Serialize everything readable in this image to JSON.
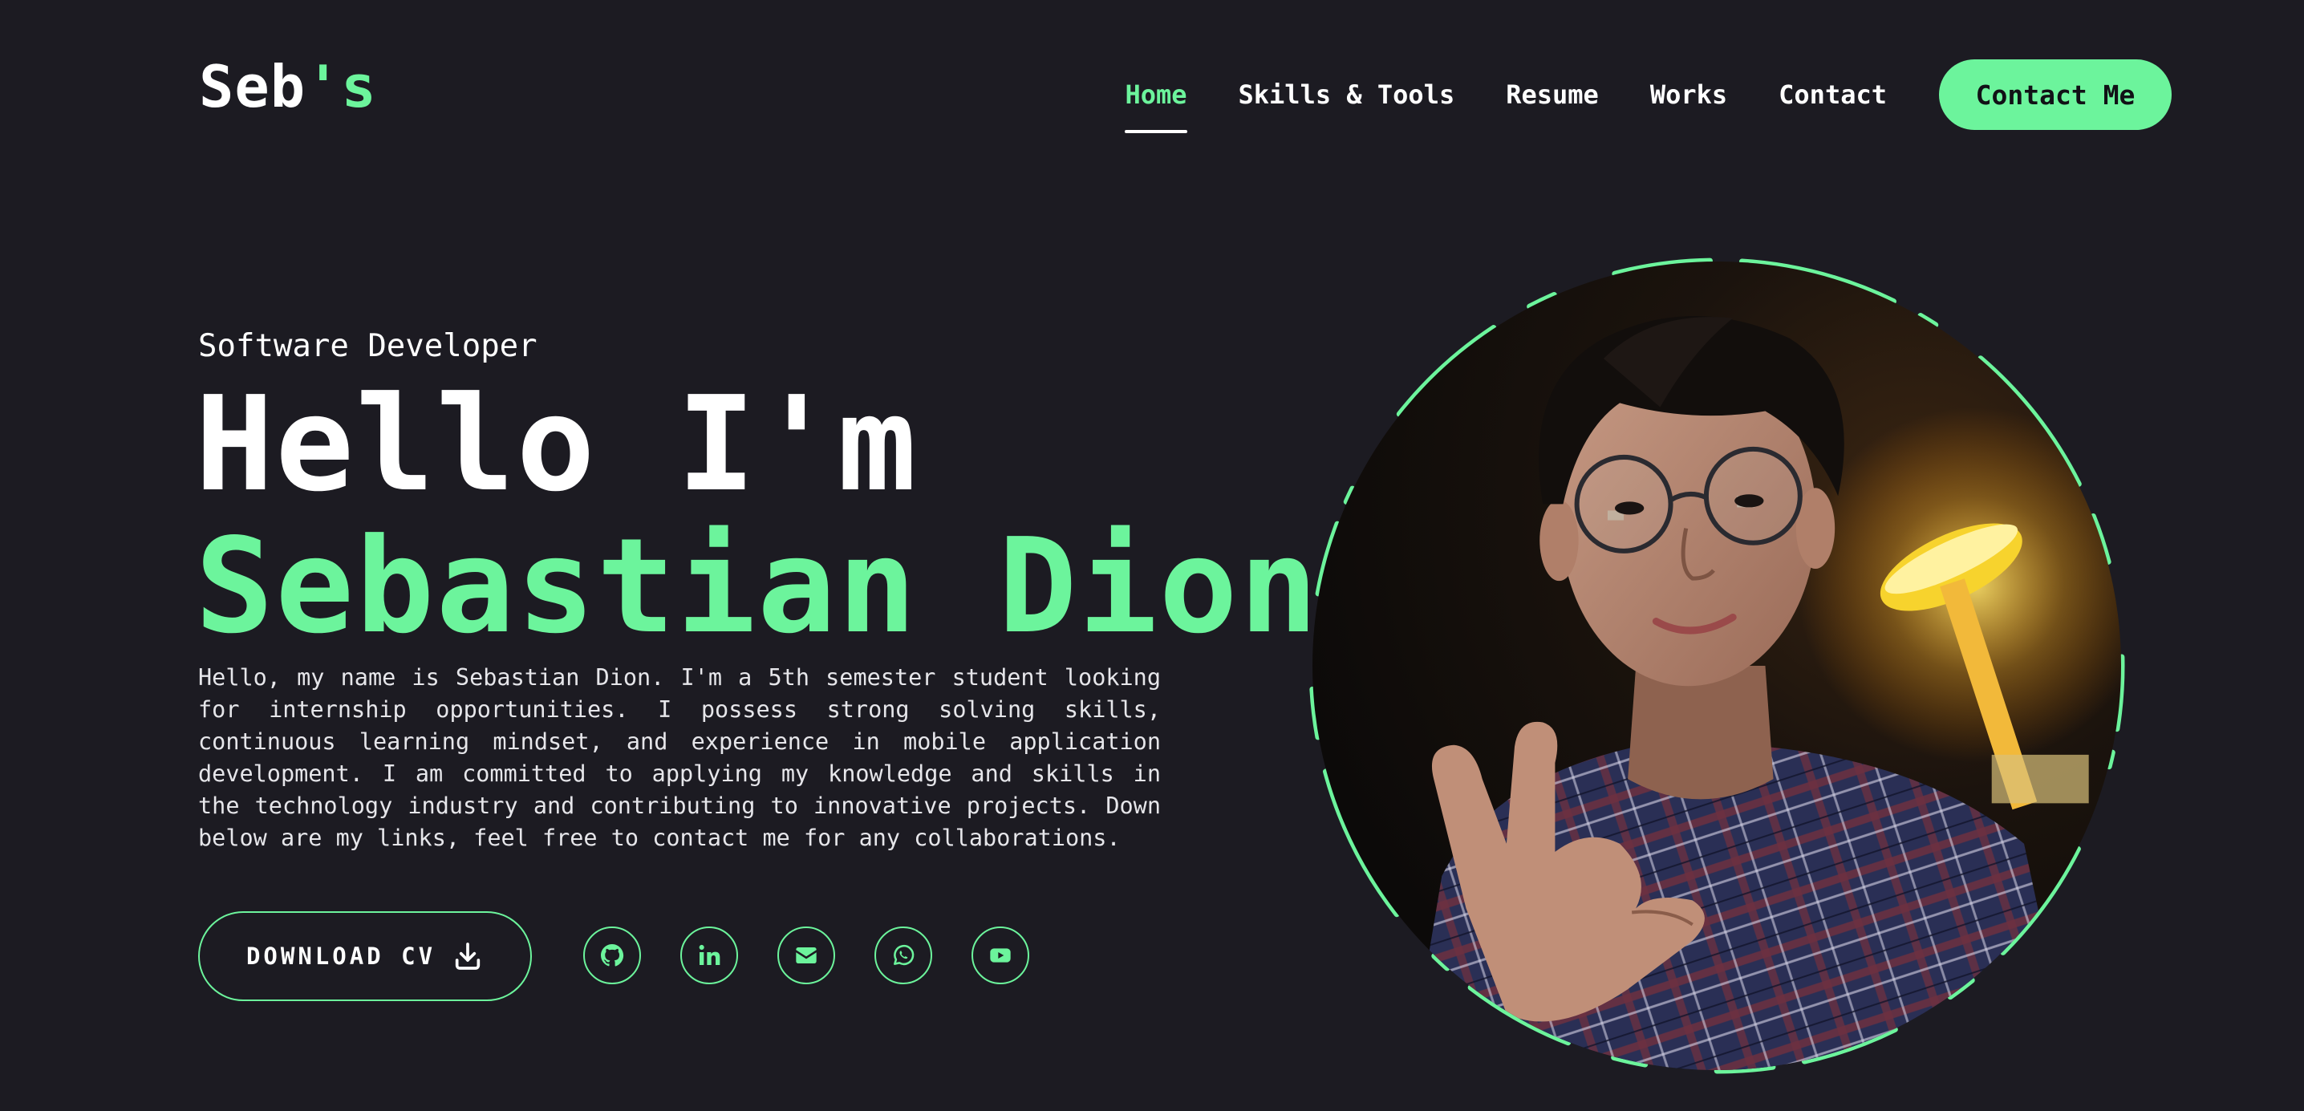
{
  "header": {
    "logo_main": "Seb",
    "logo_accent": "'s",
    "nav": [
      {
        "label": "Home",
        "active": true
      },
      {
        "label": "Skills & Tools",
        "active": false
      },
      {
        "label": "Resume",
        "active": false
      },
      {
        "label": "Works",
        "active": false
      },
      {
        "label": "Contact",
        "active": false
      }
    ],
    "cta_label": "Contact Me"
  },
  "hero": {
    "role": "Software Developer",
    "greeting": "Hello I'm",
    "name": "Sebastian Dion",
    "bio": "Hello, my name is Sebastian Dion. I'm a 5th semester student looking for internship opportunities. I possess strong solving skills, continuous learning mindset, and experience in mobile application development. I am committed to applying my knowledge and skills in the technology industry and contributing to innovative projects. Down below are my links, feel free to contact me for any collaborations."
  },
  "actions": {
    "download_label": "DOWNLOAD CV",
    "download_icon": "download-icon",
    "socials": [
      {
        "icon": "github-icon"
      },
      {
        "icon": "linkedin-icon"
      },
      {
        "icon": "email-icon"
      },
      {
        "icon": "whatsapp-icon"
      },
      {
        "icon": "youtube-icon"
      }
    ]
  },
  "portrait": {
    "subject": "portrait-photo"
  },
  "colors": {
    "background": "#1c1b22",
    "accent": "#6cf49c",
    "text": "#ffffff"
  }
}
